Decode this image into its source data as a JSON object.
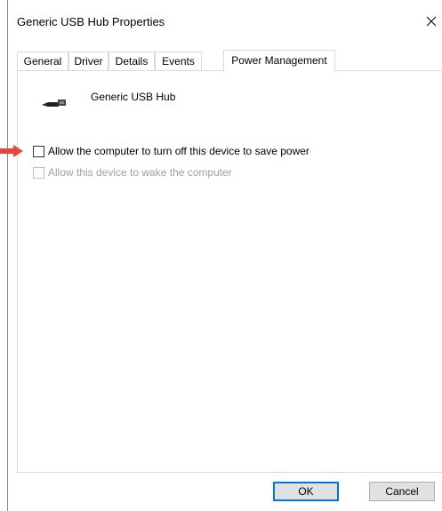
{
  "window": {
    "title": "Generic USB Hub Properties"
  },
  "tabs": [
    {
      "label": "General"
    },
    {
      "label": "Driver"
    },
    {
      "label": "Details"
    },
    {
      "label": "Events"
    },
    {
      "label": "Power Management"
    }
  ],
  "active_tab": "Power Management",
  "device": {
    "name": "Generic USB Hub",
    "icon": "usb-plug-icon"
  },
  "options": [
    {
      "label": "Allow the computer to turn off this device to save power",
      "checked": false,
      "enabled": true
    },
    {
      "label": "Allow this device to wake the computer",
      "checked": false,
      "enabled": false
    }
  ],
  "buttons": {
    "ok": "OK",
    "cancel": "Cancel"
  },
  "annotation": {
    "arrow_color": "#e8453c"
  }
}
